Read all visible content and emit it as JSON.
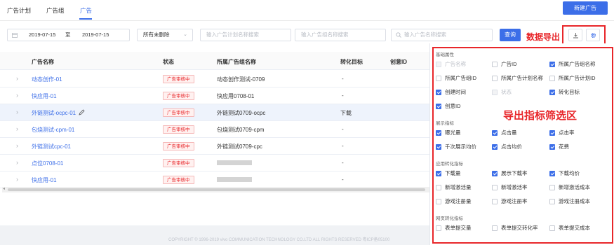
{
  "tabs": [
    "广告计划",
    "广告组",
    "广告"
  ],
  "new_ad_button": "新建广告",
  "filters": {
    "date_start": "2019-07-15",
    "date_sep": "至",
    "date_end": "2019-07-15",
    "status_select": "所有未删除",
    "plan_search_placeholder": "输入广告计划名称搜索",
    "group_search_placeholder": "输入广告组名称搜索",
    "ad_search_placeholder": "输入广告名称搜索",
    "query_button": "查询"
  },
  "annotations": {
    "export": "数据导出",
    "filter_area": "导出指标筛选区"
  },
  "table": {
    "headers": [
      "广告名称",
      "状态",
      "所属广告组名称",
      "转化目标",
      "创意ID"
    ],
    "rows": [
      {
        "name": "动态创作-01",
        "status": "广告审核中",
        "group": "动态创作测试-0709",
        "target": "-",
        "blurred": false,
        "highlight": false,
        "edit": false
      },
      {
        "name": "快应用-01",
        "status": "广告审核中",
        "group": "快应用0708-01",
        "target": "-",
        "blurred": false,
        "highlight": false,
        "edit": false
      },
      {
        "name": "外链测试-ocpc-01",
        "status": "广告审核中",
        "group": "外链测试0709-ocpc",
        "target": "下载",
        "blurred": false,
        "highlight": true,
        "edit": true
      },
      {
        "name": "包烧测试-cpm-01",
        "status": "广告审核中",
        "group": "包烧测试0709-cpm",
        "target": "-",
        "blurred": false,
        "highlight": false,
        "edit": false
      },
      {
        "name": "外链测试cpc-01",
        "status": "广告审核中",
        "group": "外链测试0709-cpc",
        "target": "-",
        "blurred": false,
        "highlight": false,
        "edit": false
      },
      {
        "name": "点位0708-01",
        "status": "广告审核中",
        "group": "",
        "target": "-",
        "blurred": true,
        "highlight": false,
        "edit": false
      },
      {
        "name": "快应用-01",
        "status": "广告审核中",
        "group": "",
        "target": "-",
        "blurred": true,
        "highlight": false,
        "edit": false
      }
    ]
  },
  "metrics_panel": {
    "groups": [
      {
        "title": "基础属性",
        "items": [
          {
            "label": "广告名称",
            "state": "disabled"
          },
          {
            "label": "广告ID",
            "state": "unchecked"
          },
          {
            "label": "所属广告组名称",
            "state": "checked"
          },
          {
            "label": "所属广告组ID",
            "state": "unchecked"
          },
          {
            "label": "所属广告计划名称",
            "state": "unchecked"
          },
          {
            "label": "所属广告计划ID",
            "state": "unchecked"
          },
          {
            "label": "创建时间",
            "state": "checked"
          },
          {
            "label": "状态",
            "state": "disabled"
          },
          {
            "label": "转化目标",
            "state": "checked"
          },
          {
            "label": "创意ID",
            "state": "checked"
          }
        ]
      },
      {
        "title": "展示指标",
        "items": [
          {
            "label": "曝光量",
            "state": "checked"
          },
          {
            "label": "点击量",
            "state": "checked"
          },
          {
            "label": "点击率",
            "state": "checked"
          },
          {
            "label": "千次展示均价",
            "state": "checked"
          },
          {
            "label": "点击均价",
            "state": "checked"
          },
          {
            "label": "花费",
            "state": "checked"
          }
        ]
      },
      {
        "title": "应用转化指标",
        "items": [
          {
            "label": "下载量",
            "state": "checked"
          },
          {
            "label": "展示下载率",
            "state": "checked"
          },
          {
            "label": "下载均价",
            "state": "checked"
          },
          {
            "label": "新增激活量",
            "state": "unchecked"
          },
          {
            "label": "新增激活率",
            "state": "unchecked"
          },
          {
            "label": "新增激活成本",
            "state": "unchecked"
          },
          {
            "label": "游戏注册量",
            "state": "unchecked"
          },
          {
            "label": "游戏注册率",
            "state": "unchecked"
          },
          {
            "label": "游戏注册成本",
            "state": "unchecked"
          }
        ]
      },
      {
        "title": "网页转化指标",
        "items": [
          {
            "label": "表单提交量",
            "state": "unchecked"
          },
          {
            "label": "表单提交转化率",
            "state": "unchecked"
          },
          {
            "label": "表单提交成本",
            "state": "unchecked"
          }
        ]
      }
    ]
  },
  "footer": {
    "copyright": "COPYRIGHT © 1996-2019 vivo COMMUNICATION TECHNOLOGY CO.LTD ALL RIGHTS RESERVED 粤ICP备05100"
  },
  "colors": {
    "primary": "#3c6ee8",
    "annotation_red": "#e8262a",
    "status_tag": "#e8262a"
  }
}
